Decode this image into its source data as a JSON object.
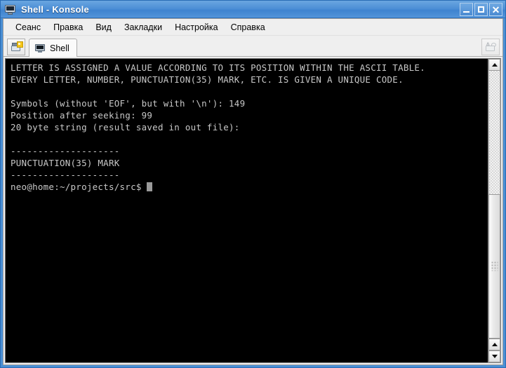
{
  "window": {
    "title": "Shell - Konsole",
    "icon": "terminal-monitor-icon",
    "accent_color": "#4a8fd4",
    "controls": {
      "minimize_label": "_",
      "maximize_label": "",
      "close_label": "✕"
    }
  },
  "menubar": {
    "items": [
      {
        "label": "Сеанс"
      },
      {
        "label": "Правка"
      },
      {
        "label": "Вид"
      },
      {
        "label": "Закладки"
      },
      {
        "label": "Настройка"
      },
      {
        "label": "Справка"
      }
    ]
  },
  "tabbar": {
    "new_session_icon": "new-session-icon",
    "detach_icon": "detach-session-icon",
    "tabs": [
      {
        "label": "Shell",
        "icon": "terminal-icon",
        "active": true
      }
    ]
  },
  "terminal": {
    "foreground_color": "#c8c8c8",
    "background_color": "#000000",
    "cursor_color": "#9a9a9a",
    "lines": [
      "LETTER IS ASSIGNED A VALUE ACCORDING TO ITS POSITION WITHIN THE ASCII TABLE.",
      "EVERY LETTER, NUMBER, PUNCTUATION(35) MARK, ETC. IS GIVEN A UNIQUE CODE.",
      "",
      "Symbols (without 'EOF', but with '\\n'): 149",
      "Position after seeking: 99",
      "20 byte string (result saved in out file):",
      "",
      "--------------------",
      "PUNCTUATION(35) MARK",
      "--------------------"
    ],
    "prompt": "neo@home:~/projects/src$ "
  },
  "scrollbar": {
    "up_arrow": "▲",
    "down_arrow": "▼",
    "thumb_position_percent": 66
  }
}
